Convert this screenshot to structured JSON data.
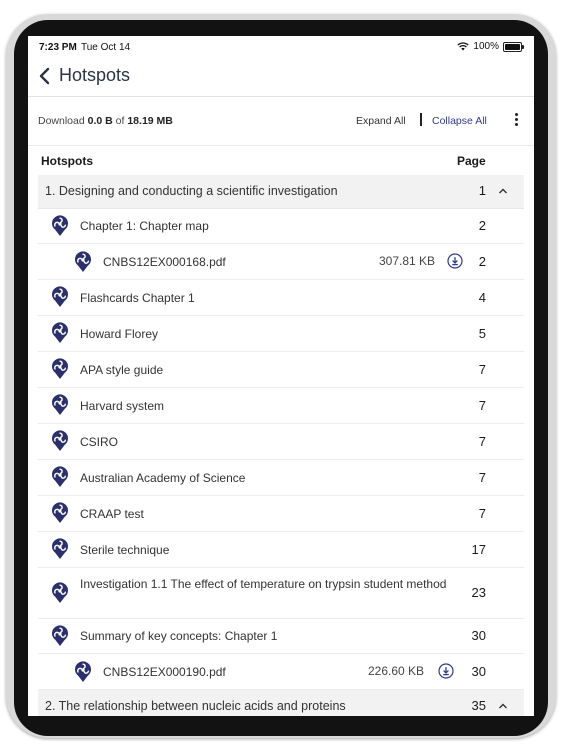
{
  "status_bar": {
    "time": "7:23 PM",
    "date": "Tue Oct 14",
    "battery": "100%"
  },
  "nav": {
    "title": "Hotspots"
  },
  "download": {
    "prefix": "Download",
    "downloaded": "0.0 B",
    "of": "of",
    "total": "18.19 MB"
  },
  "actions": {
    "expand_all": "Expand All",
    "collapse_all": "Collapse All"
  },
  "list_header": {
    "hotspots": "Hotspots",
    "page": "Page"
  },
  "sections": [
    {
      "title": "1. Designing and conducting a scientific investigation",
      "page": "1"
    },
    {
      "title": "2. The relationship between nucleic acids and proteins",
      "page": "35"
    }
  ],
  "items": [
    {
      "label": "Chapter 1: Chapter map",
      "page": "2"
    },
    {
      "label": "CNBS12EX000168.pdf",
      "page": "2",
      "size": "307.81 KB"
    },
    {
      "label": "Flashcards Chapter 1",
      "page": "4"
    },
    {
      "label": "Howard Florey",
      "page": "5"
    },
    {
      "label": "APA style guide",
      "page": "7"
    },
    {
      "label": "Harvard system",
      "page": "7"
    },
    {
      "label": "CSIRO",
      "page": "7"
    },
    {
      "label": "Australian Academy of Science",
      "page": "7"
    },
    {
      "label": "CRAAP test",
      "page": "7"
    },
    {
      "label": "Sterile technique",
      "page": "17"
    },
    {
      "label": "Investigation 1.1 The effect of temperature on trypsin student method",
      "page": "23"
    },
    {
      "label": "Summary of key concepts: Chapter 1",
      "page": "30"
    },
    {
      "label": "CNBS12EX000190.pdf",
      "page": "30",
      "size": "226.60 KB"
    }
  ],
  "colors": {
    "accent": "#2f3a8a",
    "pin": "#2b2f6b",
    "section_bg": "#f2f2f2"
  }
}
